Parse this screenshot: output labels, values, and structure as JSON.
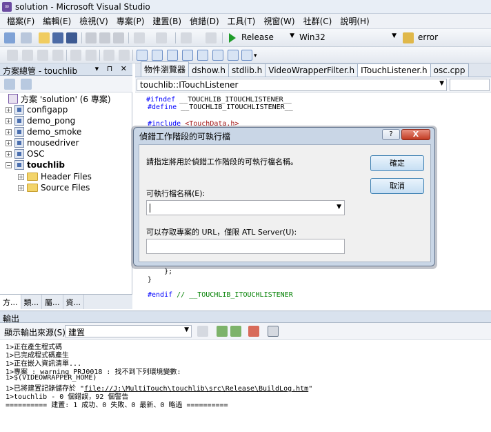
{
  "window": {
    "title": "solution - Microsoft Visual Studio"
  },
  "menu": [
    "檔案(F)",
    "編輯(E)",
    "檢視(V)",
    "專案(P)",
    "建置(B)",
    "偵錯(D)",
    "工具(T)",
    "視窗(W)",
    "社群(C)",
    "說明(H)"
  ],
  "toolbar": {
    "configuration": "Release",
    "platform": "Win32",
    "find_value": "error"
  },
  "solution_explorer": {
    "title": "方案總管 - touchlib",
    "header_buttons": "▾ ⊓ ✕",
    "solution_label": "方案 'solution' (6 專案)",
    "projects": [
      "configapp",
      "demo_pong",
      "demo_smoke",
      "mousedriver",
      "OSC",
      "touchlib"
    ],
    "folders": [
      "Header Files",
      "Source Files"
    ],
    "bottom_tabs": [
      "方...",
      "類...",
      "屬...",
      "資..."
    ]
  },
  "editor": {
    "tabs": [
      "物件瀏覽器",
      "dshow.h",
      "stdlib.h",
      "VideoWrapperFilter.h",
      "ITouchListener.h",
      "osc.cpp"
    ],
    "active_tab": "ITouchListener.h",
    "nav_scope": "touchlib::ITouchListener",
    "code": {
      "l1_kw": "#ifndef",
      "l1_rest": " __TOUCHLIB_ITOUCHLISTENER__",
      "l2_kw": "#define",
      "l2_rest": " __TOUCHLIB_ITOUCHLISTENER__",
      "l3_kw": "#include",
      "l3_str": " <TouchData.h>",
      "l4": "    };",
      "l5": "}",
      "l6_kw": "#endif",
      "l6_cmt": " // __TOUCHLIB_ITOUCHLISTENER"
    }
  },
  "dialog": {
    "title": "偵錯工作階段的可執行檔",
    "help_label": "?",
    "close_label": "X",
    "prompt": "請指定將用於偵錯工作階段的可執行檔名稱。",
    "ok_label": "確定",
    "cancel_label": "取消",
    "exe_label": "可執行檔名稱(E):",
    "exe_value": "",
    "url_label": "可以存取專案的 URL，僅限 ATL Server(U):",
    "url_value": ""
  },
  "output": {
    "title": "輸出",
    "source_label": "顯示輸出來源(S):",
    "source_value": "建置",
    "lines": [
      "1>正在產生程式碼",
      "1>已完成程式碼產生",
      "1>正在嵌入資訊清單...",
      "1>專案 : warning PRJ0018 : 找不到下列環境變數:",
      "1>$(VIDEOWRAPPER_HOME)",
      "1>touchlib - 0 個錯誤，92 個警告",
      "========== 建置: 1 成功、0 失敗、0 最新、0 略過 =========="
    ],
    "log_prefix": "1>已將建置記錄儲存於 \"",
    "log_link": "file://J:\\MultiTouch\\touchlib\\src\\Release\\BuildLog.htm",
    "log_suffix": "\""
  }
}
